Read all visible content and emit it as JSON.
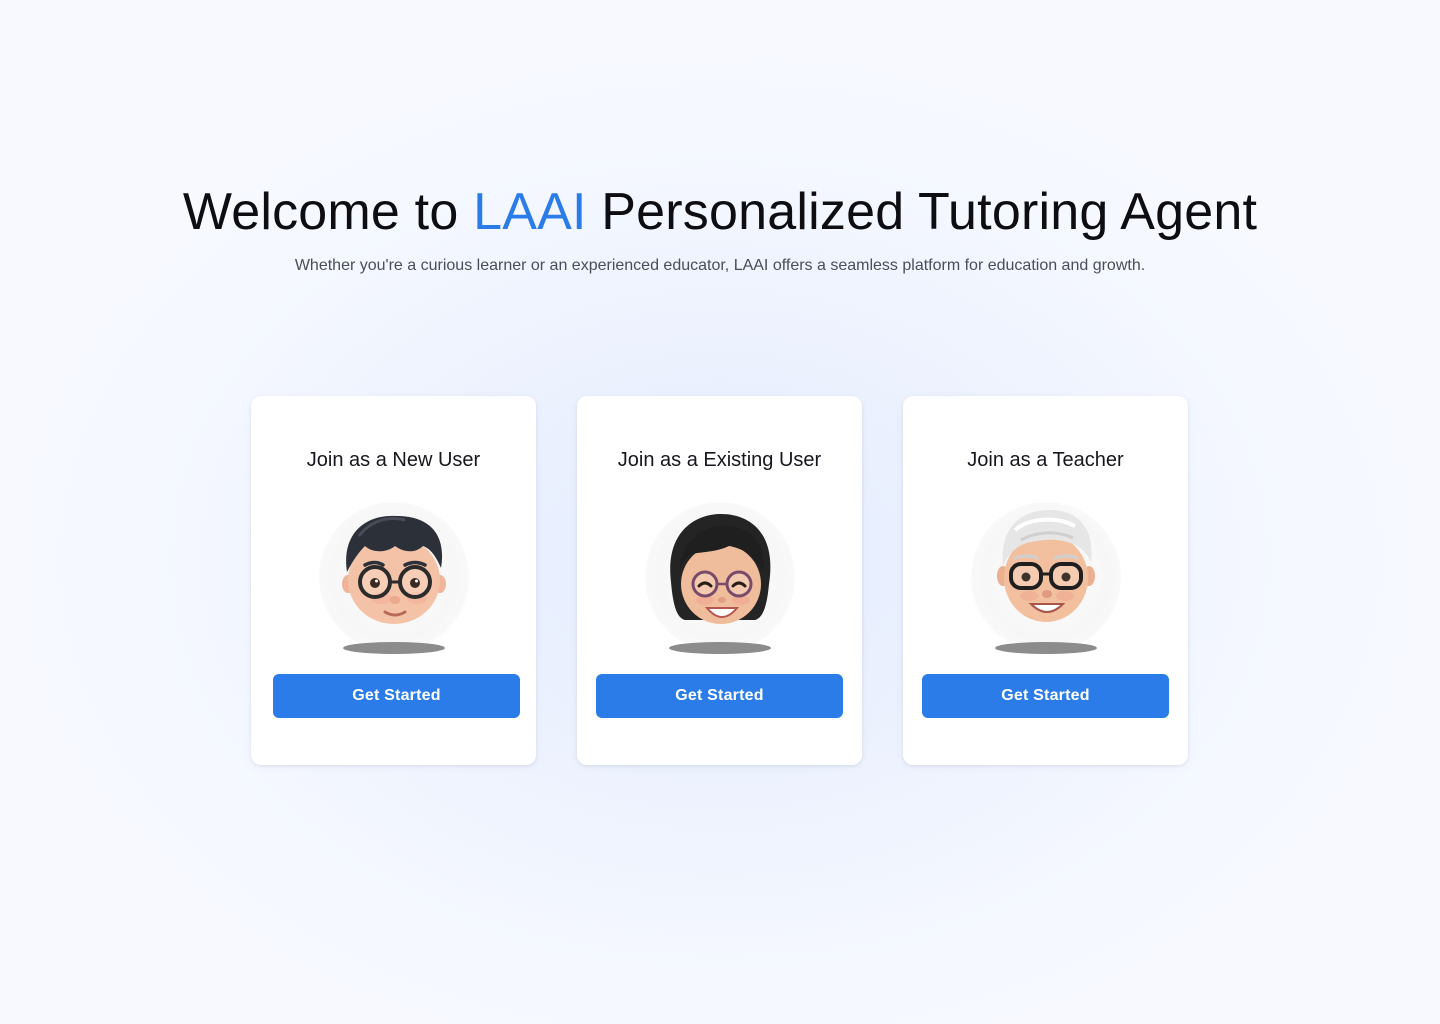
{
  "hero": {
    "title_prefix": "Welcome to ",
    "title_brand": "LAAI",
    "title_suffix": " Personalized Tutoring Agent",
    "subtitle": "Whether you're a curious learner or an experienced educator, LAAI offers a seamless platform for education and growth."
  },
  "colors": {
    "brand": "#2b7ce9",
    "button": "#2b7ce9",
    "card": "#ffffff"
  },
  "cards": [
    {
      "title": "Join as a New User",
      "avatar_icon": "young-man-glasses-avatar-icon",
      "button_label": "Get Started"
    },
    {
      "title": "Join as a Existing User",
      "avatar_icon": "woman-glasses-avatar-icon",
      "button_label": "Get Started"
    },
    {
      "title": "Join as a Teacher",
      "avatar_icon": "older-man-glasses-avatar-icon",
      "button_label": "Get Started"
    }
  ]
}
